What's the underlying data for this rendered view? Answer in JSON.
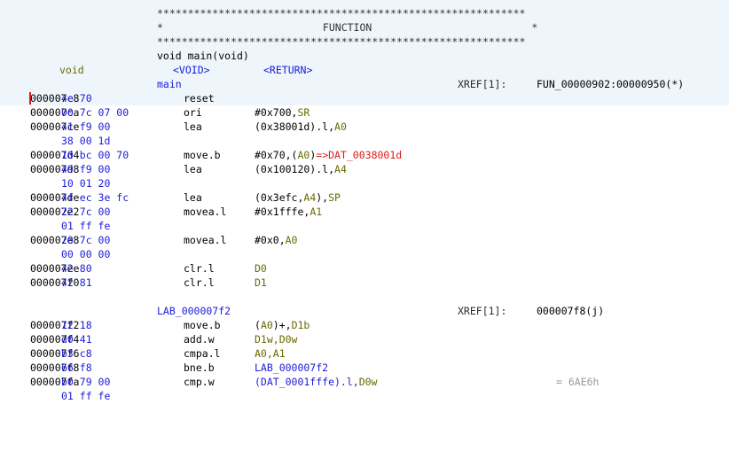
{
  "header": {
    "stars": "************************************************************",
    "function_banner": "*                          FUNCTION                          *",
    "signature": "void main(void)",
    "return_type": "void",
    "void_tag": "<VOID>",
    "return_tag": "<RETURN>",
    "func_name": "main",
    "xref_label": "XREF[1]:",
    "xref_value": "FUN_00000902:00000950(*)"
  },
  "instructions": [
    {
      "addr": "000007c8",
      "bytes": "4e 70",
      "mnemonic": "reset"
    },
    {
      "addr": "000007ca",
      "bytes": "00 7c 07 00",
      "mnemonic": "ori",
      "op1": "#0x700,",
      "op2": "SR"
    },
    {
      "addr": "000007ce",
      "bytes": "41 f9 00",
      "mnemonic": "lea",
      "op1": "(0x38001d).l,",
      "op2": "A0"
    },
    {
      "bytes": "38 00 1d"
    },
    {
      "addr": "000007d4",
      "bytes": "10 bc 00 70",
      "mnemonic": "move.b",
      "op1": "#0x70,(",
      "op2": "A0",
      "op3": ")",
      "op4": "=>DAT_0038001d"
    },
    {
      "addr": "000007d8",
      "bytes": "49 f9 00",
      "mnemonic": "lea",
      "op1": "(0x100120).l,",
      "op2": "A4"
    },
    {
      "bytes": "10 01 20"
    },
    {
      "addr": "000007de",
      "bytes": "4f ec 3e fc",
      "mnemonic": "lea",
      "op1": "(0x3efc,",
      "op2": "A4",
      "op3": "),",
      "op4": "SP"
    },
    {
      "addr": "000007e2",
      "bytes": "22 7c 00",
      "mnemonic": "movea.l",
      "op1": "#0x1fffe,",
      "op2": "A1"
    },
    {
      "bytes": "01 ff fe"
    },
    {
      "addr": "000007e8",
      "bytes": "20 7c 00",
      "mnemonic": "movea.l",
      "op1": "#0x0,",
      "op2": "A0"
    },
    {
      "bytes": "00 00 00"
    },
    {
      "addr": "000007ee",
      "bytes": "42 80",
      "mnemonic": "clr.l",
      "op2": "D0"
    },
    {
      "addr": "000007f0",
      "bytes": "42 81",
      "mnemonic": "clr.l",
      "op2": "D1"
    }
  ],
  "label_block": {
    "label": "LAB_000007f2",
    "xref_label": "XREF[1]:",
    "xref_value": "000007f8(j)"
  },
  "instructions2": [
    {
      "addr": "000007f2",
      "bytes": "12 18",
      "mnemonic": "move.b",
      "op1": "(",
      "op2": "A0",
      "op3": ")+,",
      "op4": "D1b"
    },
    {
      "addr": "000007f4",
      "bytes": "d0 41",
      "mnemonic": "add.w",
      "op1": "D1w,",
      "op2": "D0w"
    },
    {
      "addr": "000007f6",
      "bytes": "b3 c8",
      "mnemonic": "cmpa.l",
      "op1": "A0,",
      "op2": "A1"
    },
    {
      "addr": "000007f8",
      "bytes": "66 f8",
      "mnemonic": "bne.b",
      "op1": "LAB_000007f2"
    },
    {
      "addr": "000007fa",
      "bytes": "b0 79 00",
      "mnemonic": "cmp.w",
      "op1": "(DAT_0001fffe).l,",
      "op2": "D0w",
      "comment": "= 6AE6h"
    },
    {
      "bytes": "01 ff fe"
    }
  ],
  "colors": {
    "address": "#000000",
    "bytes": "#1c1cd8",
    "register": "#6a6a00",
    "symbol_ref": "#d81c1c",
    "label": "#1c1cd8",
    "header_bg": "#eef6fc",
    "comment": "#9a9a9a"
  }
}
